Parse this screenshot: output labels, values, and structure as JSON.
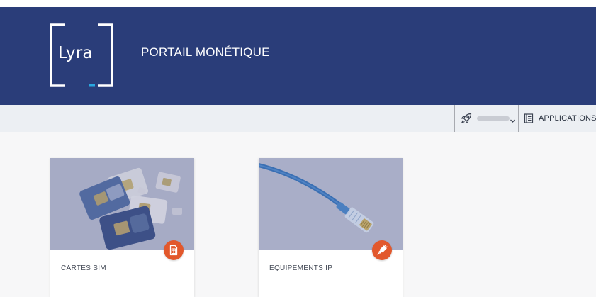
{
  "header": {
    "logo_text": "Lyra",
    "portal_title": "PORTAIL MONÉTIQUE",
    "background_color": "#2a3d79"
  },
  "toolbar": {
    "user_icon": "rocket-icon",
    "user_name": "",
    "user_dropdown_icon": "chevron-down-icon",
    "applications_icon": "book-icon",
    "applications_label": "APPLICATIONS"
  },
  "cards": [
    {
      "label": "CARTES SIM",
      "image": "sim-cards-photo",
      "badge_icon": "sim-card-icon",
      "badge_color": "#e2582c"
    },
    {
      "label": "EQUIPEMENTS IP",
      "image": "ethernet-cable-photo",
      "badge_icon": "plug-icon",
      "badge_color": "#e2582c"
    }
  ]
}
